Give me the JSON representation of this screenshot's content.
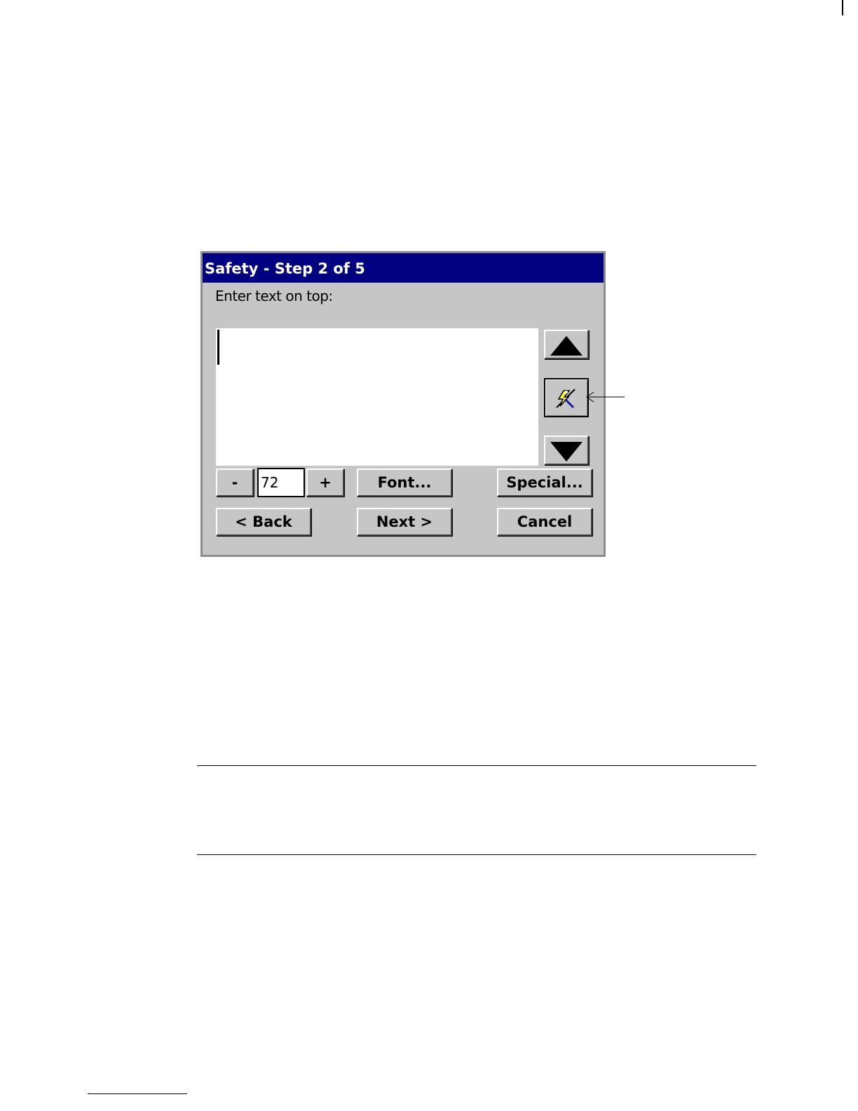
{
  "dialog": {
    "title": "Safety - Step 2 of 5",
    "prompt": "Enter text on top:",
    "text_value": "",
    "font_size": {
      "decrease_label": "-",
      "value": "72",
      "increase_label": "+"
    },
    "font_label": "Font...",
    "special_label": "Special...",
    "back_label": "< Back",
    "next_label": "Next >",
    "cancel_label": "Cancel",
    "side_buttons": {
      "up_icon": "triangle-up-icon",
      "wizard_icon": "wizard-wand-icon",
      "down_icon": "triangle-down-icon"
    }
  },
  "colors": {
    "titlebar": "#000080",
    "dialog_face": "#c6c6c6",
    "text_area": "#ffffff"
  }
}
